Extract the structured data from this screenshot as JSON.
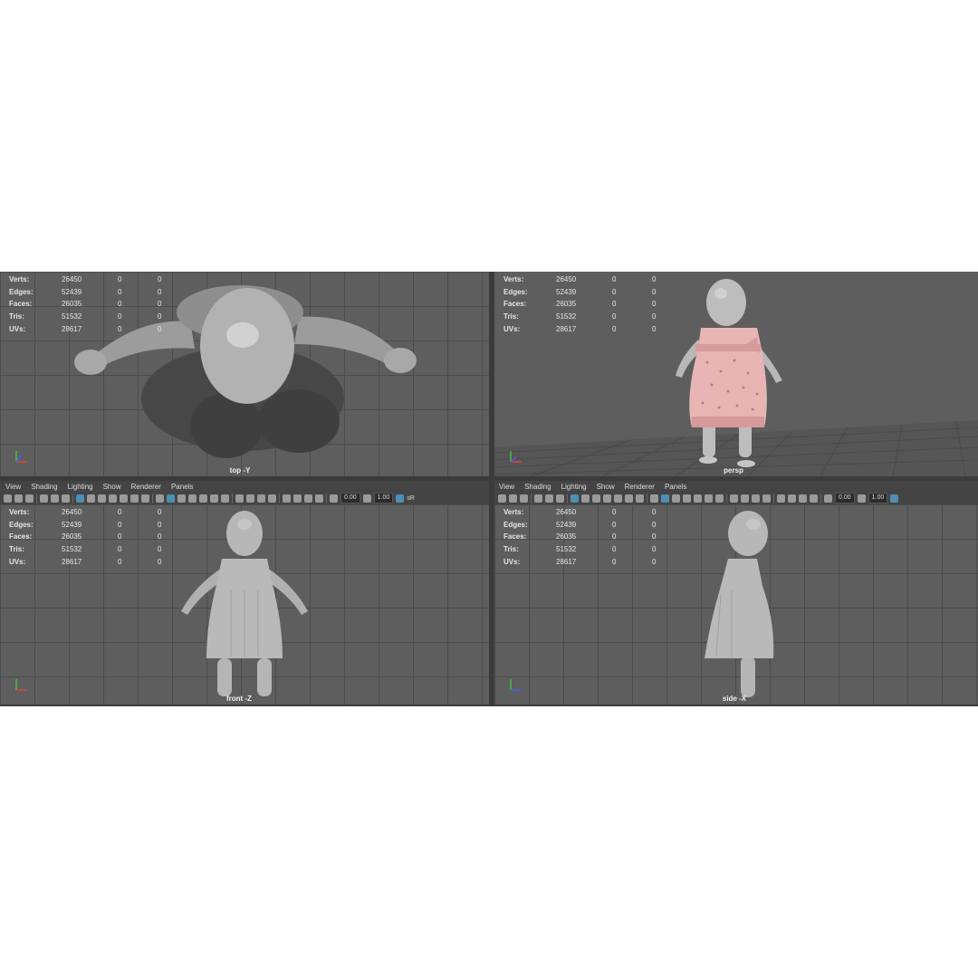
{
  "menus": [
    "View",
    "Shading",
    "Lighting",
    "Show",
    "Renderer",
    "Panels"
  ],
  "toolbar": {
    "exposure": "0.00",
    "gamma": "1.00",
    "colorspace_tag": "sR"
  },
  "stats": {
    "labels": [
      "Verts:",
      "Edges:",
      "Faces:",
      "Tris:",
      "UVs:"
    ],
    "values": [
      "26450",
      "52439",
      "26035",
      "51532",
      "28617"
    ],
    "sel": [
      "0",
      "0",
      "0",
      "0",
      "0"
    ],
    "comp": [
      "0",
      "0",
      "0",
      "0",
      "0"
    ]
  },
  "viewports": [
    {
      "camera": "top -Y"
    },
    {
      "camera": "persp"
    },
    {
      "camera": "front -Z"
    },
    {
      "camera": "side -X"
    }
  ],
  "colors": {
    "viewport_bg": "#5e5e5e",
    "grid": "#4b4b4b",
    "dress_pink": "#e8b4b4",
    "body_gray": "#bdbdbd",
    "toolbar_active": "#4d8fb3"
  }
}
